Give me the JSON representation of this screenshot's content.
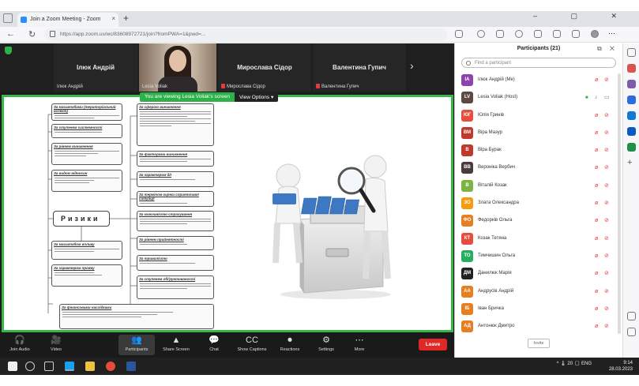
{
  "browser": {
    "tab_title": "Join a Zoom Meeting - Zoom",
    "url": "https://app.zoom.us/wc/83608972721/join?fromPWA=1&pwd=...",
    "tab_close": "×",
    "new_tab": "+"
  },
  "meeting": {
    "gallery": [
      {
        "name": "Ілюк Андрій",
        "caption": "Ілюк Андрій"
      },
      {
        "name": "Lesia Voliak",
        "caption": "Lesia Voliak"
      },
      {
        "name": "Мирослава Сідор",
        "caption": "Мирослава Сідор"
      },
      {
        "name": "Валентина Гупич",
        "caption": "Валентина Гупич"
      }
    ],
    "next_arrow": "›",
    "share_banner": "You are viewing Lesia Voliak's screen",
    "view_options": "View Options ▾"
  },
  "slide": {
    "central_label": "Ризики",
    "boxes": [
      "За масштабами (територіальний аспект)",
      "За сферою виникнення",
      "За ступенем системності",
      "За рівнем виникнення",
      "За видом відносин",
      "За факторами виникнення",
      "За характером дії",
      "За терміном оцінки сприятливої ситуації",
      "За можливістю страхування",
      "За рівнем прийнятності",
      "За масштабом впливу",
      "За тривалістю",
      "За ступенем обґрунтованості",
      "За фінансовими наслідками",
      "За характером прояву"
    ]
  },
  "participants": {
    "title": "Participants (21)",
    "search_placeholder": "Find a participant",
    "invite_label": "Invite",
    "people": [
      {
        "initials": "ІА",
        "name": "Ілюк Андрій (Me)",
        "color": "#8e44ad"
      },
      {
        "initials": "LV",
        "name": "Lesia Voliak (Host)",
        "color": "#5a4a42"
      },
      {
        "initials": "ЮГ",
        "name": "Юлія Гринів",
        "color": "#e74c3c"
      },
      {
        "initials": "ВМ",
        "name": "Віра Мазур",
        "color": "#c0392b"
      },
      {
        "initials": "В",
        "name": "Віра Бурак",
        "color": "#c0392b"
      },
      {
        "initials": "ВВ",
        "name": "Вероніка Вербич",
        "color": "#4a3a3a"
      },
      {
        "initials": "В",
        "name": "Віталій Козак",
        "color": "#7cb342"
      },
      {
        "initials": "ЗО",
        "name": "Злата Олександра",
        "color": "#f39c12"
      },
      {
        "initials": "ФО",
        "name": "Федорків Ольга",
        "color": "#e67e22"
      },
      {
        "initials": "КТ",
        "name": "Козак Тетяна",
        "color": "#e74c3c"
      },
      {
        "initials": "ТО",
        "name": "Тимчишин Ольга",
        "color": "#27ae60"
      },
      {
        "initials": "ДМ",
        "name": "Данилюк Марія",
        "color": "#222222"
      },
      {
        "initials": "АА",
        "name": "Андрусів Андрій",
        "color": "#e67e22"
      },
      {
        "initials": "ІБ",
        "name": "Іван Бричка",
        "color": "#e67e22"
      },
      {
        "initials": "АД",
        "name": "Антонюк Дмитро",
        "color": "#e67e22"
      }
    ]
  },
  "toolbar": {
    "buttons": [
      {
        "icon": "🎧",
        "label": "Join Audio"
      },
      {
        "icon": "🎥",
        "label": "Video"
      },
      {
        "icon": "👥",
        "label": "Participants"
      },
      {
        "icon": "▲",
        "label": "Share Screen"
      },
      {
        "icon": "💬",
        "label": "Chat"
      },
      {
        "icon": "CC",
        "label": "Show Captions"
      },
      {
        "icon": "⏺",
        "label": "Reactions"
      },
      {
        "icon": "⚙",
        "label": "Settings"
      },
      {
        "icon": "⋯",
        "label": "More"
      }
    ],
    "leave_label": "Leave"
  },
  "taskbar": {
    "tray_text": "^ 🌡 20 ◻ ENG",
    "time": "9:14",
    "date": "28.03.2023"
  },
  "colors": {
    "share_border": "#39b54a",
    "leave": "#e02828",
    "zoom_dark": "#1a1a1a"
  }
}
